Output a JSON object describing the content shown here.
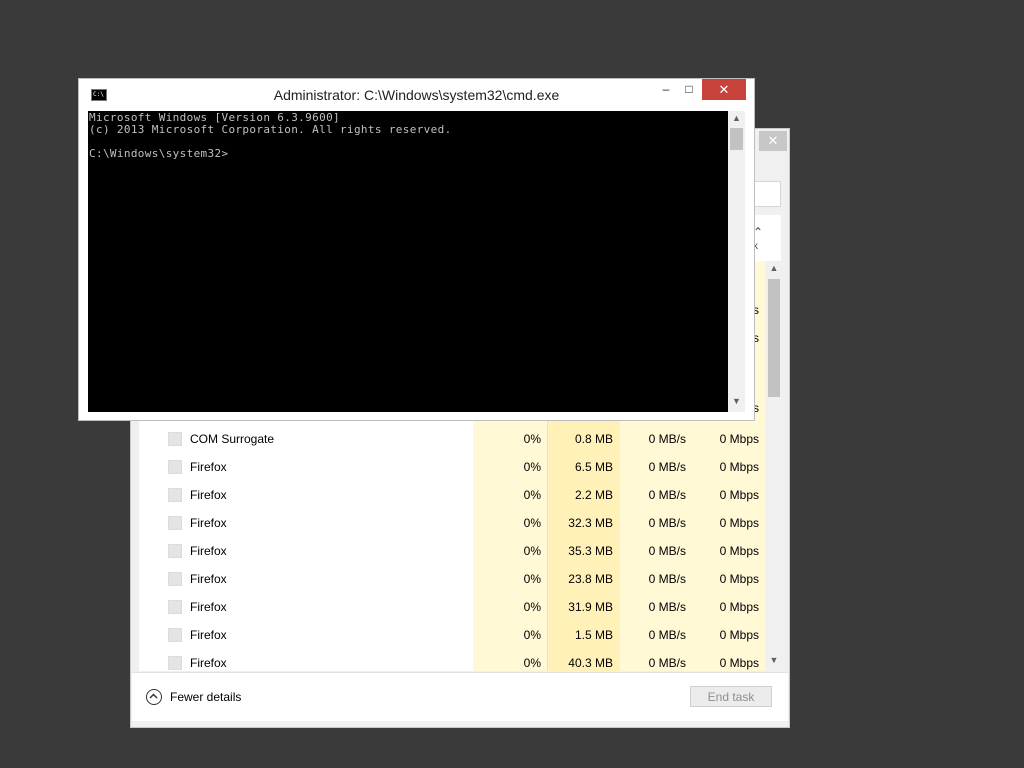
{
  "cmd_window": {
    "title": "Administrator: C:\\Windows\\system32\\cmd.exe",
    "icon_label": "C:\\",
    "minimize_glyph": "–",
    "maximize_glyph": "□",
    "close_glyph": "✕",
    "console_lines": [
      "Microsoft Windows [Version 6.3.9600]",
      "(c) 2013 Microsoft Corporation. All rights reserved.",
      "",
      "C:\\Windows\\system32>"
    ],
    "scroll_up_glyph": "▲",
    "scroll_down_glyph": "▼"
  },
  "task_manager": {
    "close_glyph": "✕",
    "processes": [
      {
        "name": "COM Surrogate",
        "cpu": "0%",
        "memory": "0.8 MB",
        "disk": "0 MB/s",
        "network": "0 Mbps"
      },
      {
        "name": "Firefox",
        "cpu": "0%",
        "memory": "6.5 MB",
        "disk": "0 MB/s",
        "network": "0 Mbps"
      },
      {
        "name": "Firefox",
        "cpu": "0%",
        "memory": "2.2 MB",
        "disk": "0 MB/s",
        "network": "0 Mbps"
      },
      {
        "name": "Firefox",
        "cpu": "0%",
        "memory": "32.3 MB",
        "disk": "0 MB/s",
        "network": "0 Mbps"
      },
      {
        "name": "Firefox",
        "cpu": "0%",
        "memory": "35.3 MB",
        "disk": "0 MB/s",
        "network": "0 Mbps"
      },
      {
        "name": "Firefox",
        "cpu": "0%",
        "memory": "23.8 MB",
        "disk": "0 MB/s",
        "network": "0 Mbps"
      },
      {
        "name": "Firefox",
        "cpu": "0%",
        "memory": "31.9 MB",
        "disk": "0 MB/s",
        "network": "0 Mbps"
      },
      {
        "name": "Firefox",
        "cpu": "0%",
        "memory": "1.5 MB",
        "disk": "0 MB/s",
        "network": "0 Mbps"
      },
      {
        "name": "Firefox",
        "cpu": "0%",
        "memory": "40.3 MB",
        "disk": "0 MB/s",
        "network": "0 Mbps"
      }
    ],
    "hidden_rows_visible_text": [
      "s",
      "s",
      "s"
    ],
    "fewer_details_label": "Fewer details",
    "end_task_label": "End task",
    "scroll_up_glyph": "▲",
    "scroll_down_glyph": "▼"
  },
  "colors": {
    "desktop_bg": "#3a3a3a",
    "cpu_column_bg": "#fff9d6",
    "memory_column_bg": "#fff1b8",
    "disk_column_bg": "#fff9d6",
    "network_column_bg": "#fff9d6",
    "close_button_red": "#c7423a"
  }
}
